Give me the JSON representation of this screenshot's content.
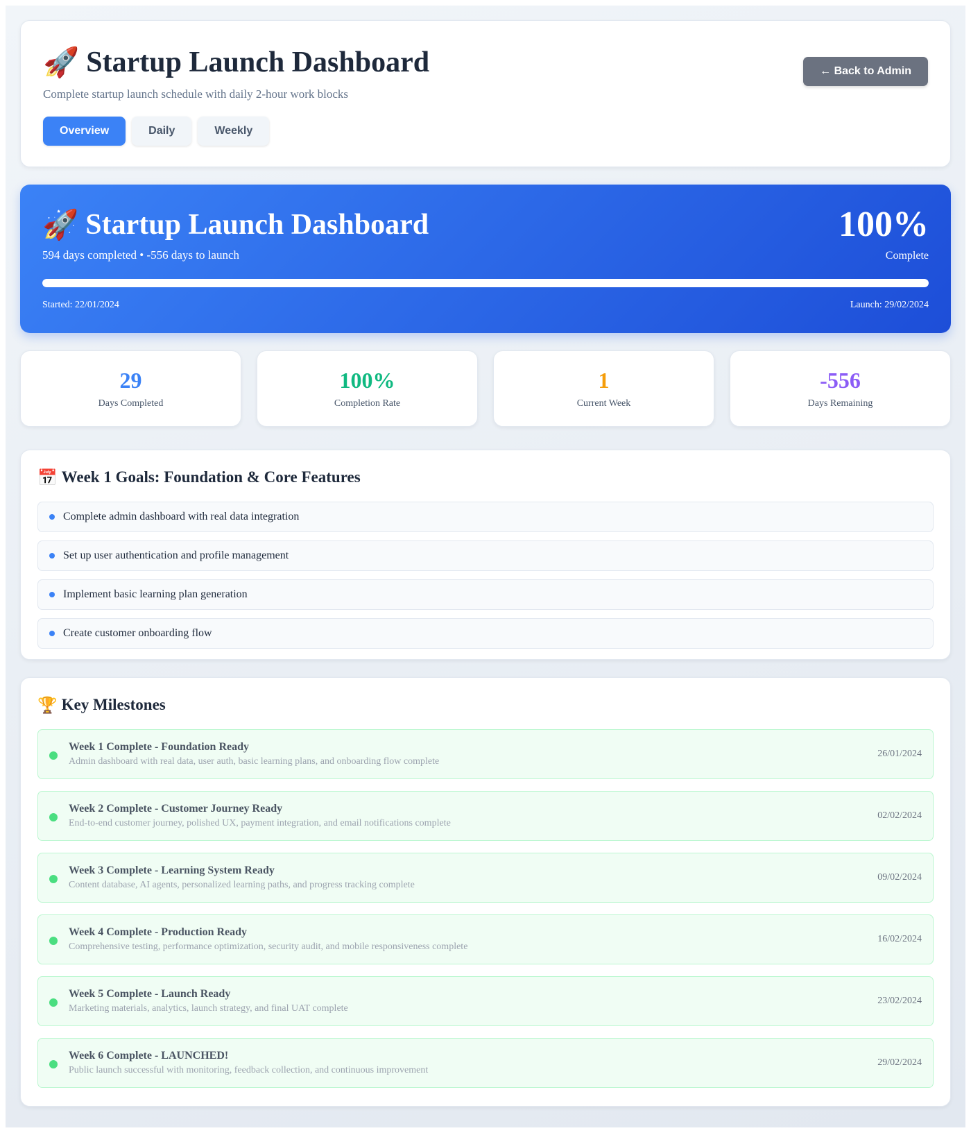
{
  "header": {
    "title_icon": "🚀",
    "title": "Startup Launch Dashboard",
    "subtitle": "Complete startup launch schedule with daily 2-hour work blocks",
    "tabs": [
      {
        "label": "Overview",
        "active": true
      },
      {
        "label": "Daily",
        "active": false
      },
      {
        "label": "Weekly",
        "active": false
      }
    ],
    "back_button": "← Back to Admin"
  },
  "hero": {
    "title_icon": "🚀",
    "title": "Startup Launch Dashboard",
    "summary": "594 days completed • -556 days to launch",
    "percent": "100%",
    "percent_label": "Complete",
    "progress_fraction": 1.0,
    "started": "Started: 22/01/2024",
    "launch": "Launch: 29/02/2024"
  },
  "stats": [
    {
      "value": "29",
      "label": "Days Completed",
      "color": "#3b82f6"
    },
    {
      "value": "100%",
      "label": "Completion Rate",
      "color": "#10b981"
    },
    {
      "value": "1",
      "label": "Current Week",
      "color": "#f59e0b"
    },
    {
      "value": "-556",
      "label": "Days Remaining",
      "color": "#8b5cf6"
    }
  ],
  "goals": {
    "icon": "📅",
    "title": "Week 1 Goals: Foundation & Core Features",
    "items": [
      "Complete admin dashboard with real data integration",
      "Set up user authentication and profile management",
      "Implement basic learning plan generation",
      "Create customer onboarding flow"
    ]
  },
  "milestones": {
    "icon": "🏆",
    "title": "Key Milestones",
    "items": [
      {
        "title": "Week 1 Complete - Foundation Ready",
        "desc": "Admin dashboard with real data, user auth, basic learning plans, and onboarding flow complete",
        "date": "26/01/2024"
      },
      {
        "title": "Week 2 Complete - Customer Journey Ready",
        "desc": "End-to-end customer journey, polished UX, payment integration, and email notifications complete",
        "date": "02/02/2024"
      },
      {
        "title": "Week 3 Complete - Learning System Ready",
        "desc": "Content database, AI agents, personalized learning paths, and progress tracking complete",
        "date": "09/02/2024"
      },
      {
        "title": "Week 4 Complete - Production Ready",
        "desc": "Comprehensive testing, performance optimization, security audit, and mobile responsiveness complete",
        "date": "16/02/2024"
      },
      {
        "title": "Week 5 Complete - Launch Ready",
        "desc": "Marketing materials, analytics, launch strategy, and final UAT complete",
        "date": "23/02/2024"
      },
      {
        "title": "Week 6 Complete - LAUNCHED!",
        "desc": "Public launch successful with monitoring, feedback collection, and continuous improvement",
        "date": "29/02/2024"
      }
    ]
  },
  "colors": {
    "accent": "#3b82f6",
    "hero_gradient_start": "#3b82f6",
    "hero_gradient_end": "#1d4ed8",
    "milestone_dot": "#4ade80"
  }
}
